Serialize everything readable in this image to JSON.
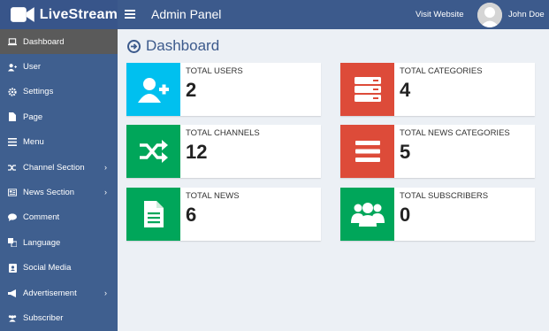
{
  "brand": {
    "name": "LiveStream"
  },
  "header": {
    "title": "Admin Panel",
    "visit_link": "Visit Website",
    "user_name": "John Doe"
  },
  "sidebar": {
    "items": [
      {
        "label": "Dashboard",
        "icon": "laptop-icon",
        "active": true
      },
      {
        "label": "User",
        "icon": "user-plus-icon"
      },
      {
        "label": "Settings",
        "icon": "gear-icon"
      },
      {
        "label": "Page",
        "icon": "file-icon"
      },
      {
        "label": "Menu",
        "icon": "bars-icon"
      },
      {
        "label": "Channel Section",
        "icon": "shuffle-icon",
        "has_submenu": true
      },
      {
        "label": "News Section",
        "icon": "newspaper-icon",
        "has_submenu": true
      },
      {
        "label": "Comment",
        "icon": "comment-icon"
      },
      {
        "label": "Language",
        "icon": "language-icon"
      },
      {
        "label": "Social Media",
        "icon": "address-card-icon"
      },
      {
        "label": "Advertisement",
        "icon": "bullhorn-icon",
        "has_submenu": true
      },
      {
        "label": "Subscriber",
        "icon": "users-icon"
      }
    ]
  },
  "main": {
    "title": "Dashboard",
    "stats": [
      {
        "label": "TOTAL USERS",
        "value": "2",
        "color": "#00c0ef",
        "icon": "user-plus-icon"
      },
      {
        "label": "TOTAL CATEGORIES",
        "value": "4",
        "color": "#dd4b39",
        "icon": "server-icon"
      },
      {
        "label": "TOTAL CHANNELS",
        "value": "12",
        "color": "#00a65a",
        "icon": "shuffle-icon"
      },
      {
        "label": "TOTAL NEWS CATEGORIES",
        "value": "5",
        "color": "#dd4b39",
        "icon": "bars-icon"
      },
      {
        "label": "TOTAL NEWS",
        "value": "6",
        "color": "#00a65a",
        "icon": "file-text-icon"
      },
      {
        "label": "TOTAL SUBSCRIBERS",
        "value": "0",
        "color": "#00a65a",
        "icon": "users-icon"
      }
    ]
  },
  "colors": {
    "header": "#3c5a8c",
    "sidebar": "#3f5f8f",
    "active_item": "#5a5a5a",
    "page_bg": "#ecf0f5"
  }
}
